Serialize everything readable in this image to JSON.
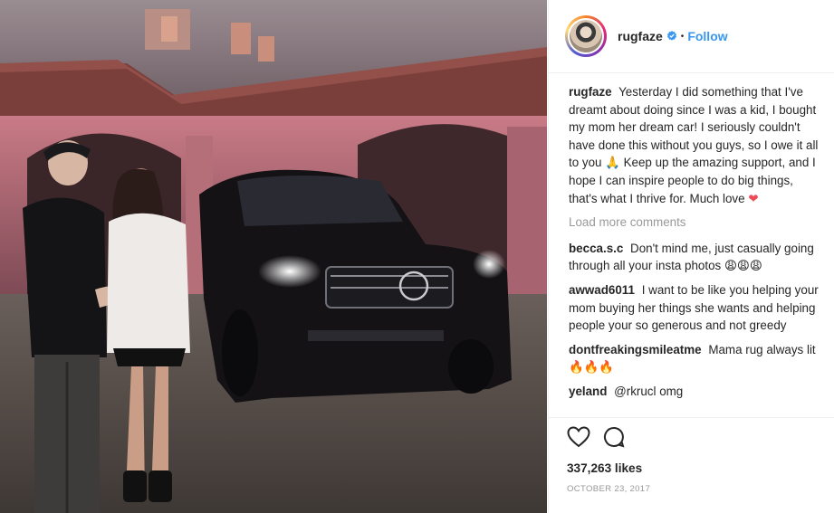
{
  "post": {
    "username": "rugfaze",
    "separator": "•",
    "follow_label": "Follow",
    "caption_username": "rugfaze",
    "caption_text": "Yesterday I did something that I've dreamt about doing since I was a kid, I bought my mom her dream car! I seriously couldn't have done this without you guys, so I owe it all to you 🙏 Keep up the amazing support, and I hope I can inspire people to do big things, that's what I thrive for. Much love",
    "caption_heart": "❤",
    "load_more_label": "Load more comments",
    "comments": [
      {
        "user": "becca.s.c",
        "text": "Don't mind me, just casually going through all your insta photos 😩😩😩"
      },
      {
        "user": "awwad6011",
        "text": "I want to be like you helping your mom buying her things she wants and helping people your so generous and not greedy"
      },
      {
        "user": "dontfreakingsmileatme",
        "text": "Mama rug always lit 🔥🔥🔥"
      },
      {
        "user": "yeland",
        "text": "@rkrucl omg"
      }
    ],
    "likes": "337,263 likes",
    "date": "OCTOBER 23, 2017"
  },
  "colors": {
    "link_blue": "#3897f0",
    "muted_gray": "#999999",
    "heart_red": "#ed4956",
    "text_dark": "#262626"
  },
  "icons": {
    "verified": "verified-badge-icon",
    "like": "heart-outline-icon",
    "comment": "speech-bubble-icon"
  }
}
